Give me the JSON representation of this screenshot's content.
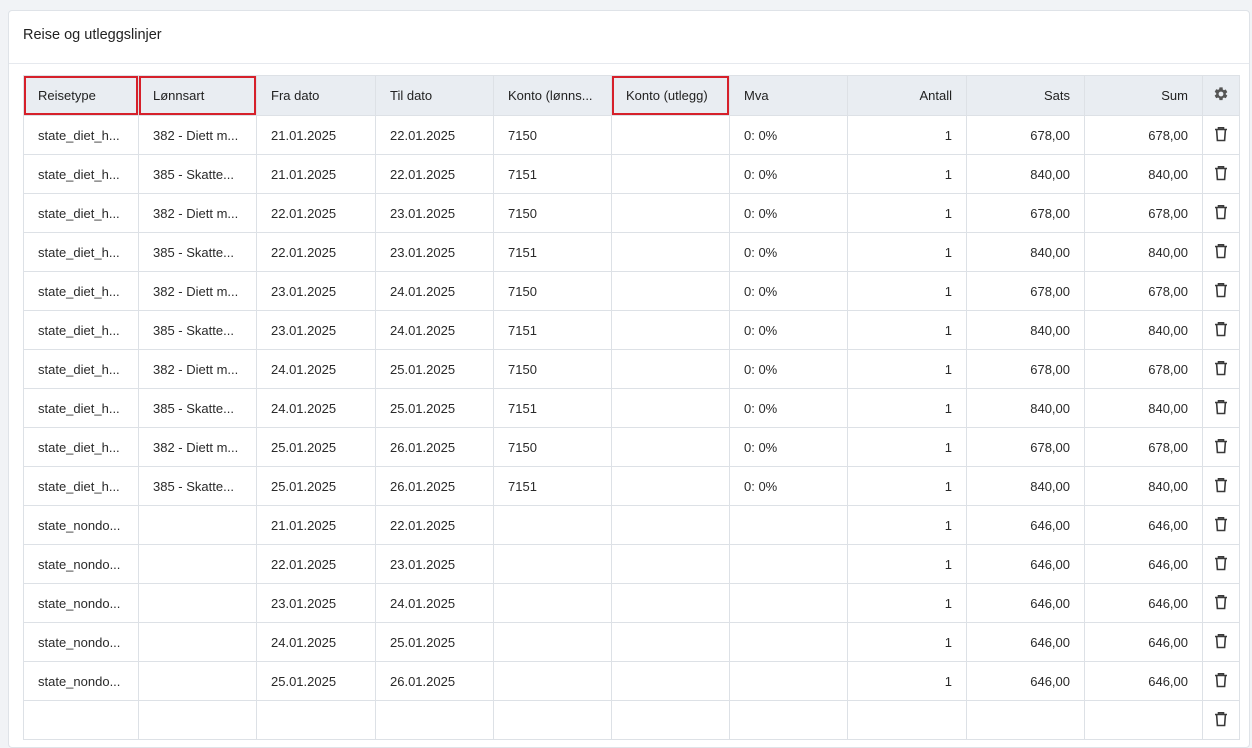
{
  "panel": {
    "title": "Reise og utleggslinjer"
  },
  "table": {
    "columns": [
      "Reisetype",
      "Lønnsart",
      "Fra dato",
      "Til dato",
      "Konto (lønns...",
      "Konto (utlegg)",
      "Mva",
      "Antall",
      "Sats",
      "Sum"
    ],
    "settings_icon": "gear-icon",
    "delete_icon": "trash-icon",
    "highlight_color": "#d6202a",
    "rows": [
      {
        "reisetype": "state_diet_h...",
        "lonnsart": "382 - Diett m...",
        "fra": "21.01.2025",
        "til": "22.01.2025",
        "konto_lonn": "7150",
        "konto_utlegg": "",
        "mva": "0: 0%",
        "antall": "1",
        "sats": "678,00",
        "sum": "678,00"
      },
      {
        "reisetype": "state_diet_h...",
        "lonnsart": "385 - Skatte...",
        "fra": "21.01.2025",
        "til": "22.01.2025",
        "konto_lonn": "7151",
        "konto_utlegg": "",
        "mva": "0: 0%",
        "antall": "1",
        "sats": "840,00",
        "sum": "840,00"
      },
      {
        "reisetype": "state_diet_h...",
        "lonnsart": "382 - Diett m...",
        "fra": "22.01.2025",
        "til": "23.01.2025",
        "konto_lonn": "7150",
        "konto_utlegg": "",
        "mva": "0: 0%",
        "antall": "1",
        "sats": "678,00",
        "sum": "678,00"
      },
      {
        "reisetype": "state_diet_h...",
        "lonnsart": "385 - Skatte...",
        "fra": "22.01.2025",
        "til": "23.01.2025",
        "konto_lonn": "7151",
        "konto_utlegg": "",
        "mva": "0: 0%",
        "antall": "1",
        "sats": "840,00",
        "sum": "840,00"
      },
      {
        "reisetype": "state_diet_h...",
        "lonnsart": "382 - Diett m...",
        "fra": "23.01.2025",
        "til": "24.01.2025",
        "konto_lonn": "7150",
        "konto_utlegg": "",
        "mva": "0: 0%",
        "antall": "1",
        "sats": "678,00",
        "sum": "678,00"
      },
      {
        "reisetype": "state_diet_h...",
        "lonnsart": "385 - Skatte...",
        "fra": "23.01.2025",
        "til": "24.01.2025",
        "konto_lonn": "7151",
        "konto_utlegg": "",
        "mva": "0: 0%",
        "antall": "1",
        "sats": "840,00",
        "sum": "840,00"
      },
      {
        "reisetype": "state_diet_h...",
        "lonnsart": "382 - Diett m...",
        "fra": "24.01.2025",
        "til": "25.01.2025",
        "konto_lonn": "7150",
        "konto_utlegg": "",
        "mva": "0: 0%",
        "antall": "1",
        "sats": "678,00",
        "sum": "678,00"
      },
      {
        "reisetype": "state_diet_h...",
        "lonnsart": "385 - Skatte...",
        "fra": "24.01.2025",
        "til": "25.01.2025",
        "konto_lonn": "7151",
        "konto_utlegg": "",
        "mva": "0: 0%",
        "antall": "1",
        "sats": "840,00",
        "sum": "840,00"
      },
      {
        "reisetype": "state_diet_h...",
        "lonnsart": "382 - Diett m...",
        "fra": "25.01.2025",
        "til": "26.01.2025",
        "konto_lonn": "7150",
        "konto_utlegg": "",
        "mva": "0: 0%",
        "antall": "1",
        "sats": "678,00",
        "sum": "678,00"
      },
      {
        "reisetype": "state_diet_h...",
        "lonnsart": "385 - Skatte...",
        "fra": "25.01.2025",
        "til": "26.01.2025",
        "konto_lonn": "7151",
        "konto_utlegg": "",
        "mva": "0: 0%",
        "antall": "1",
        "sats": "840,00",
        "sum": "840,00"
      },
      {
        "reisetype": "state_nondo...",
        "lonnsart": "",
        "fra": "21.01.2025",
        "til": "22.01.2025",
        "konto_lonn": "",
        "konto_utlegg": "",
        "mva": "",
        "antall": "1",
        "sats": "646,00",
        "sum": "646,00"
      },
      {
        "reisetype": "state_nondo...",
        "lonnsart": "",
        "fra": "22.01.2025",
        "til": "23.01.2025",
        "konto_lonn": "",
        "konto_utlegg": "",
        "mva": "",
        "antall": "1",
        "sats": "646,00",
        "sum": "646,00"
      },
      {
        "reisetype": "state_nondo...",
        "lonnsart": "",
        "fra": "23.01.2025",
        "til": "24.01.2025",
        "konto_lonn": "",
        "konto_utlegg": "",
        "mva": "",
        "antall": "1",
        "sats": "646,00",
        "sum": "646,00"
      },
      {
        "reisetype": "state_nondo...",
        "lonnsart": "",
        "fra": "24.01.2025",
        "til": "25.01.2025",
        "konto_lonn": "",
        "konto_utlegg": "",
        "mva": "",
        "antall": "1",
        "sats": "646,00",
        "sum": "646,00"
      },
      {
        "reisetype": "state_nondo...",
        "lonnsart": "",
        "fra": "25.01.2025",
        "til": "26.01.2025",
        "konto_lonn": "",
        "konto_utlegg": "",
        "mva": "",
        "antall": "1",
        "sats": "646,00",
        "sum": "646,00"
      },
      {
        "reisetype": "",
        "lonnsart": "",
        "fra": "",
        "til": "",
        "konto_lonn": "",
        "konto_utlegg": "",
        "mva": "",
        "antall": "",
        "sats": "",
        "sum": ""
      }
    ]
  }
}
